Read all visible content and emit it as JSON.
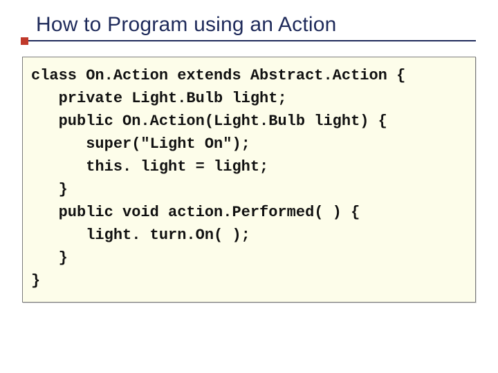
{
  "title": "How to Program using an Action",
  "code": {
    "lines": [
      "class On.Action extends Abstract.Action {",
      "   private Light.Bulb light;",
      "   public On.Action(Light.Bulb light) {",
      "      super(\"Light On\");",
      "      this. light = light;",
      "   }",
      "   public void action.Performed( ) {",
      "      light. turn.On( );",
      "   }",
      "}"
    ]
  }
}
